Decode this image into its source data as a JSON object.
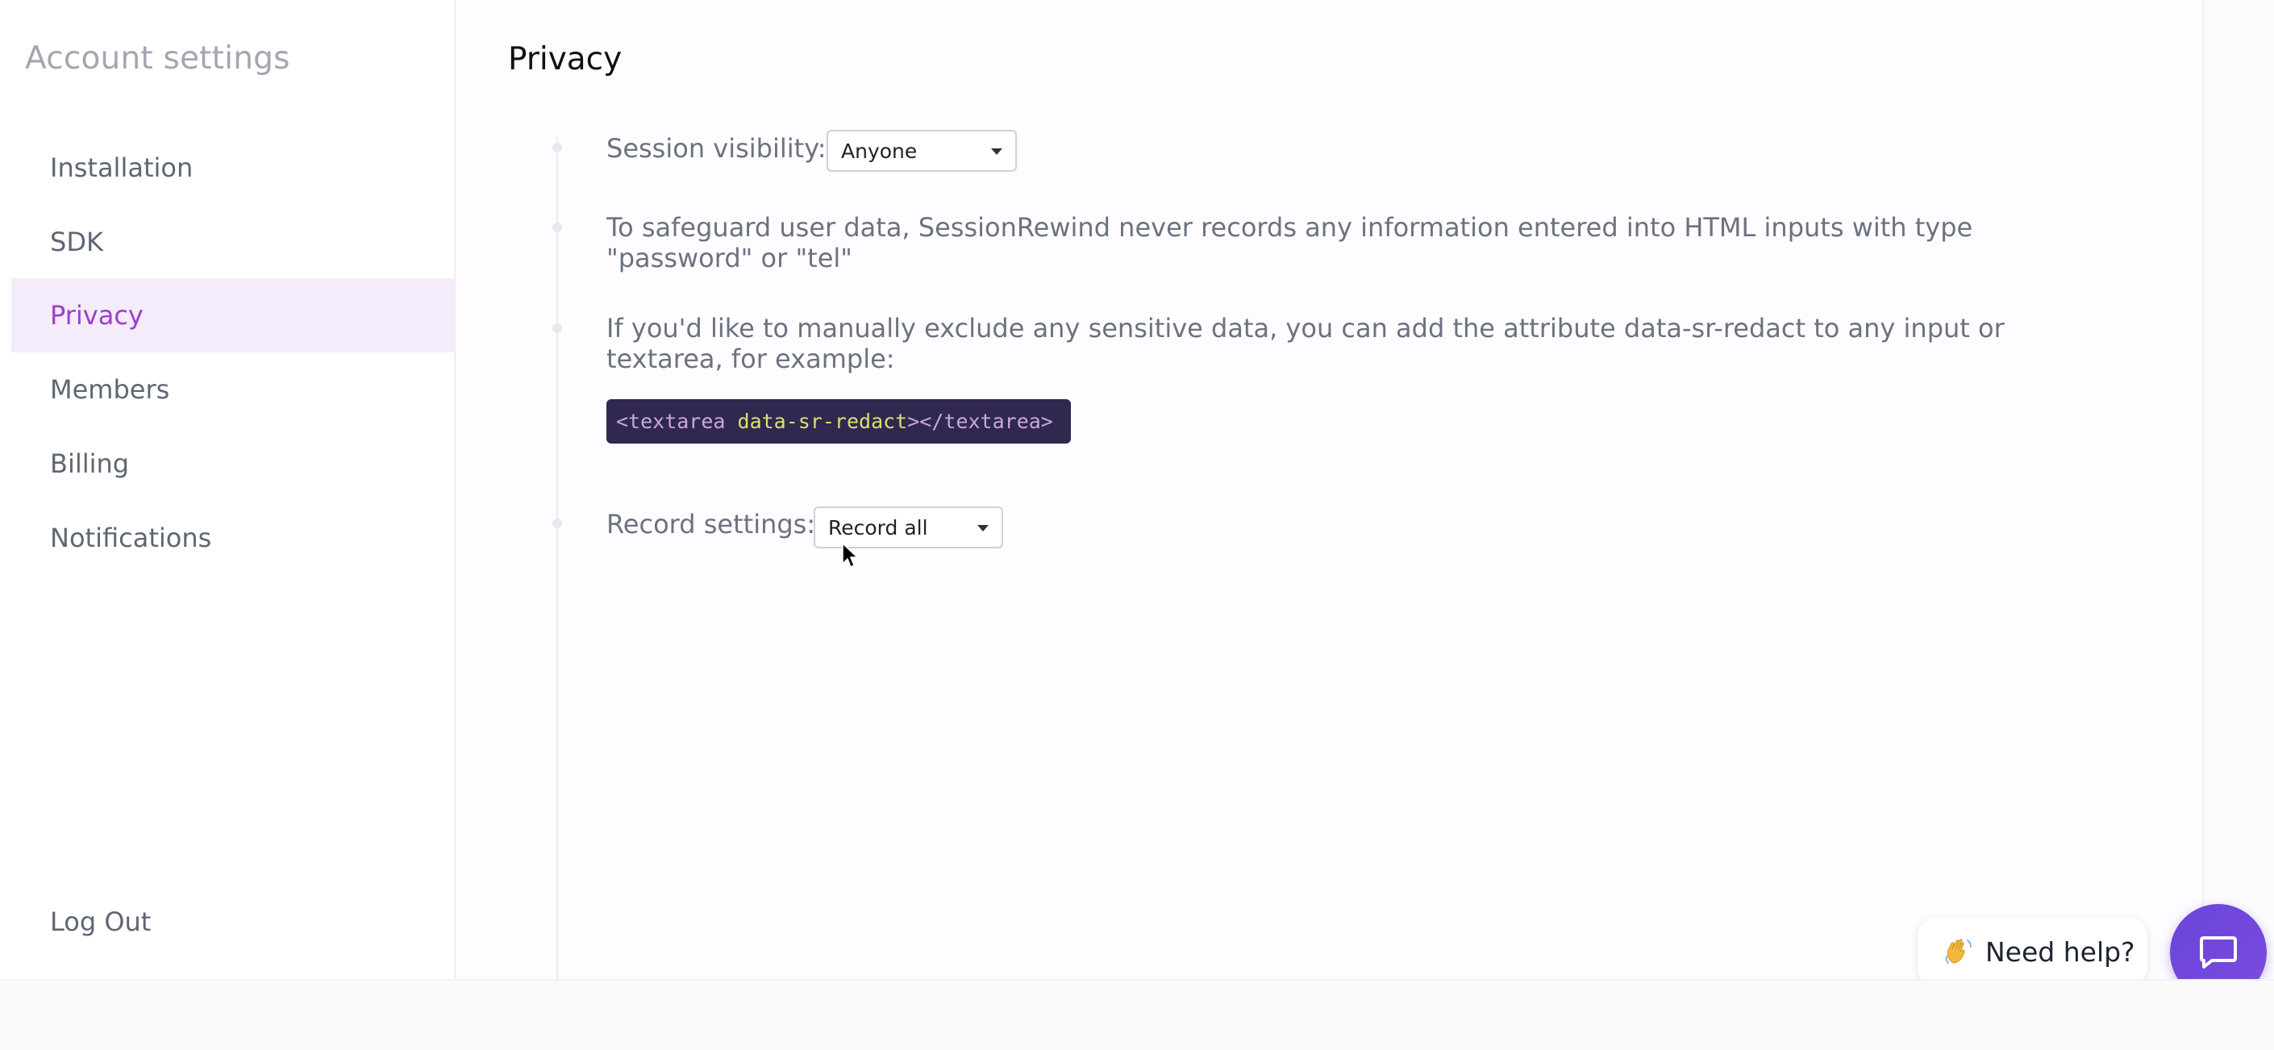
{
  "sidebar": {
    "title": "Account settings",
    "items": [
      {
        "label": "Installation"
      },
      {
        "label": "SDK"
      },
      {
        "label": "Privacy"
      },
      {
        "label": "Members"
      },
      {
        "label": "Billing"
      },
      {
        "label": "Notifications"
      }
    ],
    "active_index": 2,
    "logout_label": "Log Out"
  },
  "main": {
    "title": "Privacy",
    "session_visibility": {
      "label": "Session visibility:",
      "value": "Anyone"
    },
    "password_note": "To safeguard user data, SessionRewind never records any information entered into HTML inputs with type \"password\" or \"tel\"",
    "redact_note": "If you'd like to manually exclude any sensitive data, you can add the attribute data-sr-redact to any input or textarea, for example:",
    "code_example": {
      "open_tag": "<textarea ",
      "attribute": "data-sr-redact",
      "close_tag": "></textarea>"
    },
    "record_settings": {
      "label": "Record settings:",
      "value": "Record all"
    }
  },
  "help_widget": {
    "label": "Need help?",
    "icons": [
      "waving-hand-icon",
      "chat-icon"
    ]
  },
  "colors": {
    "accent": "#9b3fc8",
    "active_bg": "#f4ebfb",
    "code_bg": "#30284f",
    "chat_button": "#6a45d8"
  }
}
